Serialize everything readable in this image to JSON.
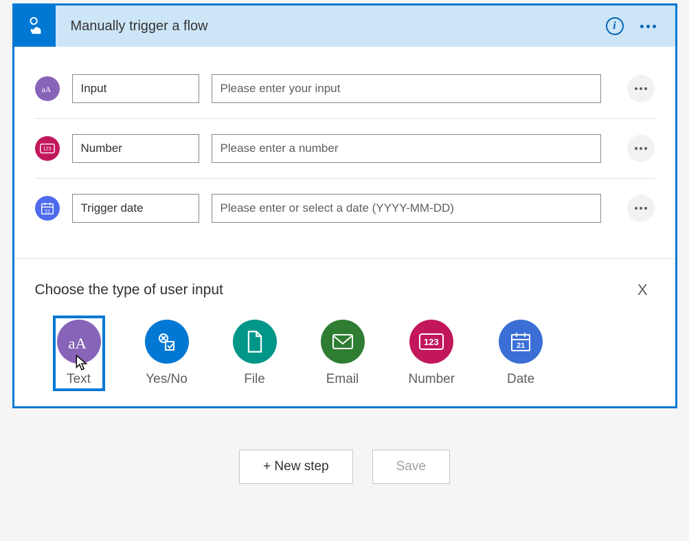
{
  "header": {
    "title": "Manually trigger a flow"
  },
  "inputs": [
    {
      "name": "Input",
      "placeholder": "Please enter your input"
    },
    {
      "name": "Number",
      "placeholder": "Please enter a number"
    },
    {
      "name": "Trigger date",
      "placeholder": "Please enter or select a date (YYYY-MM-DD)"
    }
  ],
  "chooser": {
    "title": "Choose the type of user input",
    "close": "X",
    "types": [
      {
        "label": "Text"
      },
      {
        "label": "Yes/No"
      },
      {
        "label": "File"
      },
      {
        "label": "Email"
      },
      {
        "label": "Number"
      },
      {
        "label": "Date"
      }
    ]
  },
  "footer": {
    "new_step": "+ New step",
    "save": "Save"
  }
}
